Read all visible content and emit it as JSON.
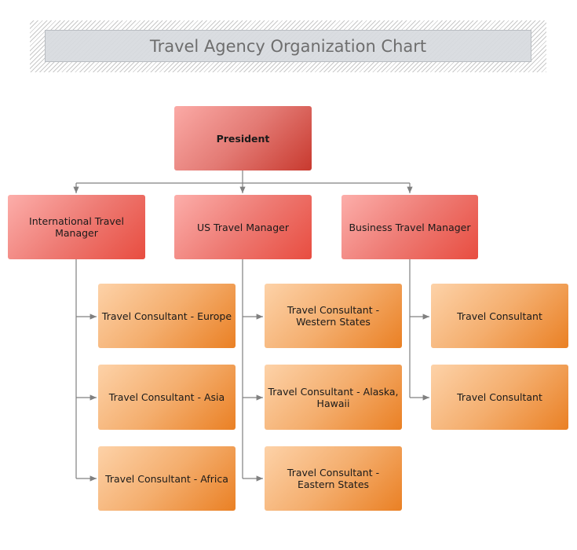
{
  "title": "Travel Agency Organization Chart",
  "colors": {
    "connector": "#808080",
    "manager": "#ee6b62",
    "consultant": "#f2a25a"
  },
  "president": {
    "label": "President"
  },
  "managers": [
    {
      "label": "International Travel Manager",
      "consultants": [
        "Travel Consultant - Europe",
        "Travel Consultant - Asia",
        "Travel Consultant - Africa"
      ]
    },
    {
      "label": "US Travel Manager",
      "consultants": [
        "Travel Consultant - Western States",
        "Travel Consultant - Alaska, Hawaii",
        "Travel Consultant - Eastern States"
      ]
    },
    {
      "label": "Business Travel Manager",
      "consultants": [
        "Travel Consultant",
        "Travel Consultant"
      ]
    }
  ]
}
